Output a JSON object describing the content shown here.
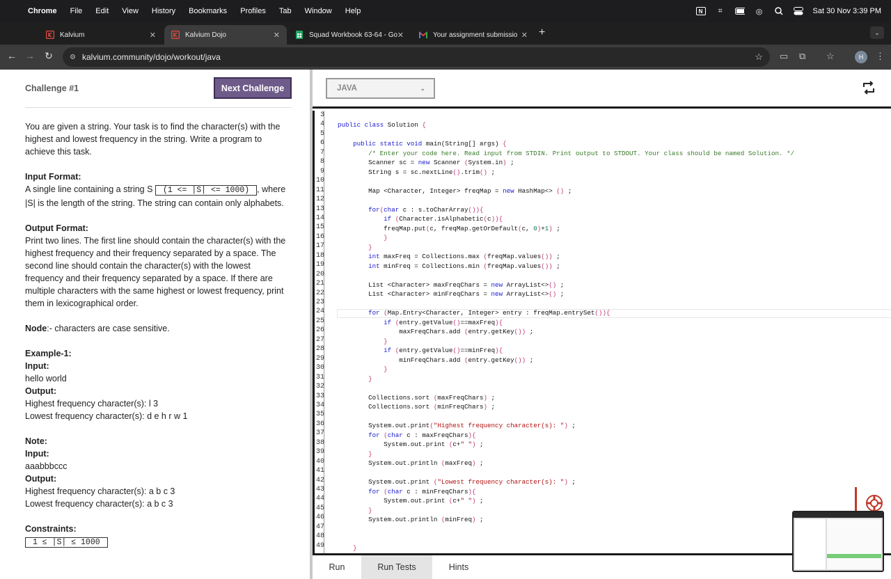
{
  "menubar": {
    "app": "Chrome",
    "items": [
      "File",
      "Edit",
      "View",
      "History",
      "Bookmarks",
      "Profiles",
      "Tab",
      "Window",
      "Help"
    ],
    "datetime": "Sat 30 Nov  3:39 PM"
  },
  "tabs": [
    {
      "title": "Kalvium",
      "favicon": "kalvium-icon",
      "active": false
    },
    {
      "title": "Kalvium Dojo",
      "favicon": "kalvium-icon",
      "active": true
    },
    {
      "title": "Squad Workbook 63-64 - Go",
      "favicon": "sheets-icon",
      "active": false
    },
    {
      "title": "Your assignment submission",
      "favicon": "gmail-icon",
      "active": false
    }
  ],
  "address": {
    "url": "kalvium.community/dojo/workout/java",
    "profile_initial": "H"
  },
  "challenge": {
    "title": "Challenge #1",
    "next_label": "Next Challenge",
    "intro": "You are given a string. Your task is to find the character(s) with the highest and lowest frequency in the string. Write a program to achieve this task.",
    "input_heading": "Input Format:",
    "input_pre": "A single line containing a string S",
    "input_constraint": "(1 <= |S| <= 1000)",
    "input_post": ", where |S| is the length of the string. The string can contain only alphabets.",
    "output_heading": "Output Format:",
    "output_text": "Print two lines. The first line should contain the character(s) with the highest frequency and their frequency separated by a space. The second line should contain the character(s) with the lowest frequency and their frequency separated by a space. If there are multiple characters with the same highest or lowest frequency, print them in lexicographical order.",
    "node_heading": "Node",
    "node_text": ":- characters are case sensitive.",
    "example_heading": "Example-1:",
    "input_label": "Input:",
    "example_input": "hello world",
    "output_label": "Output:",
    "example_out1": "Highest frequency character(s): l 3",
    "example_out2": "Lowest frequency character(s): d e h r w 1",
    "note_heading": "Note:",
    "note_input": "aaabbbccc",
    "note_out1": "Highest frequency character(s): a b c 3",
    "note_out2": "Lowest frequency character(s): a b c 3",
    "constraints_heading": "Constraints:",
    "constraints_value": "1 ≤ |S| ≤ 1000"
  },
  "editor": {
    "language": "JAVA",
    "line_start": 3,
    "line_end": 49,
    "footer_tabs": [
      "Run",
      "Run Tests",
      "Hints"
    ],
    "active_footer_tab": "Run Tests"
  }
}
